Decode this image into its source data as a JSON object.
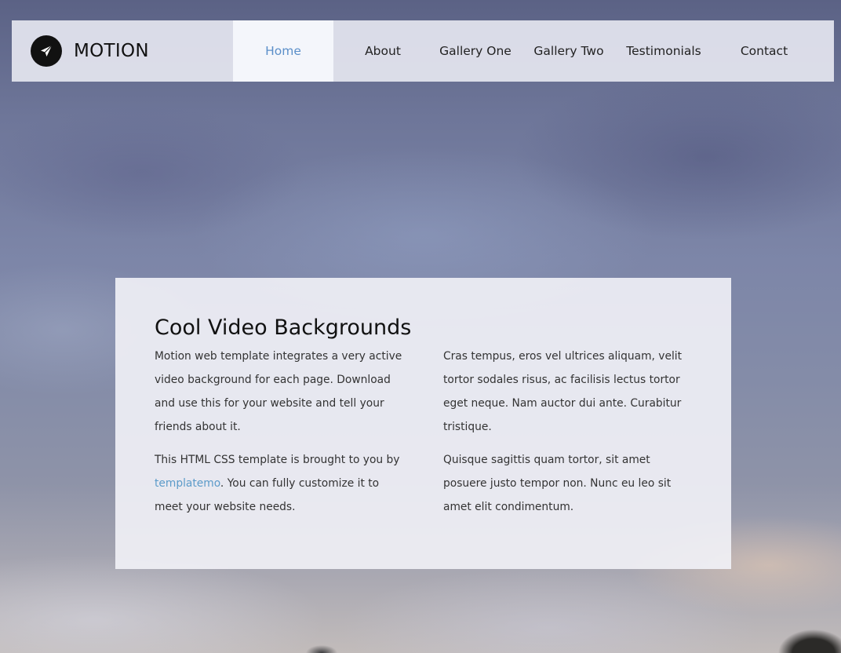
{
  "brand": {
    "name": "MOTION",
    "icon": "paper-plane-icon"
  },
  "nav": {
    "items": [
      {
        "label": "Home",
        "active": true
      },
      {
        "label": "About",
        "active": false
      },
      {
        "label": "Gallery One",
        "active": false
      },
      {
        "label": "Gallery Two",
        "active": false
      },
      {
        "label": "Testimonials",
        "active": false
      },
      {
        "label": "Contact",
        "active": false
      }
    ],
    "active_color": "#5b8fc9"
  },
  "content": {
    "title": "Cool Video Backgrounds",
    "left": {
      "p1": "Motion web template integrates a very active video background for each page. Download and use this for your website and tell your friends about it.",
      "p2_before": "This HTML CSS template is brought to you by ",
      "p2_link": "templatemo",
      "p2_after": ". You can fully customize it to meet your website needs."
    },
    "right": {
      "p1": "Cras tempus, eros vel ultrices aliquam, velit tortor sodales risus, ac facilisis lectus tortor eget neque. Nam auctor dui ante. Curabitur tristique.",
      "p2": "Quisque sagittis quam tortor, sit amet posuere justo tempor non. Nunc eu leo sit amet elit condimentum."
    },
    "link_color": "#5b9bc9"
  }
}
